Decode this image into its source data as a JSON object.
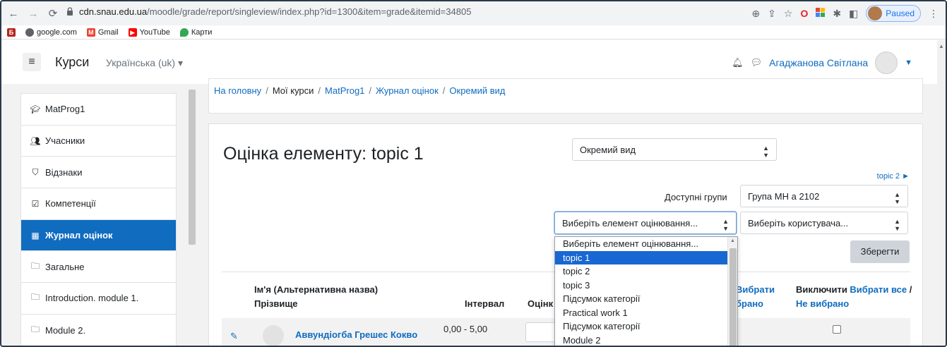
{
  "browser": {
    "url_host": "cdn.snau.edu.ua",
    "url_path": "/moodle/grade/report/singleview/index.php?id=1300&item=grade&itemid=34805",
    "profile_status": "Paused"
  },
  "bookmarks": [
    {
      "label": "",
      "icon": "b-logo-icon",
      "color": "#b3261e"
    },
    {
      "label": "google.com",
      "icon": "globe-icon",
      "color": "#5f6368"
    },
    {
      "label": "Gmail",
      "icon": "gmail-icon",
      "color": "#ea4335"
    },
    {
      "label": "YouTube",
      "icon": "youtube-icon",
      "color": "#ff0000"
    },
    {
      "label": "Карти",
      "icon": "maps-pin-icon",
      "color": "#34a853"
    }
  ],
  "navbar": {
    "brand": "Курси",
    "language": "Українська (uk) ▾",
    "user_name": "Агаджанова Світлана"
  },
  "drawer": {
    "items": [
      {
        "label": "MatProg1",
        "icon": "graduation-cap-icon",
        "glyph": "🎓",
        "active": false
      },
      {
        "label": "Учасники",
        "icon": "users-icon",
        "glyph": "👥",
        "active": false
      },
      {
        "label": "Відзнаки",
        "icon": "shield-icon",
        "glyph": "🛡",
        "active": false
      },
      {
        "label": "Компетенції",
        "icon": "checkbox-icon",
        "glyph": "☑",
        "active": false
      },
      {
        "label": "Журнал оцінок",
        "icon": "table-icon",
        "glyph": "▦",
        "active": true
      },
      {
        "label": "Загальне",
        "icon": "folder-icon",
        "glyph": "🗀",
        "active": false
      },
      {
        "label": "Introduction. module 1.",
        "icon": "folder-icon",
        "glyph": "🗀",
        "active": false
      },
      {
        "label": "Module 2.",
        "icon": "folder-icon",
        "glyph": "🗀",
        "active": false
      }
    ]
  },
  "breadcrumb": {
    "home": "На головну",
    "my_courses": "Мої курси",
    "course": "MatProg1",
    "gradebook": "Журнал оцінок",
    "current": "Окремий вид"
  },
  "page": {
    "title": "Оцінка елементу: topic 1",
    "view_select": "Окремий вид",
    "next_link": "topic 2 ►",
    "groups_label": "Доступні групи",
    "group_select": "Група МН а 2102",
    "item_select": "Виберіть елемент оцінювання...",
    "user_select": "Виберіть користувача...",
    "save_button": "Зберегти"
  },
  "table": {
    "col_name_line1": "Ім'я (Альтернативна назва)",
    "col_name_line2": "Прізвище",
    "col_interval": "Інтервал",
    "col_grade": "Оцінк",
    "col_override_line1": "Вибрати",
    "col_override_line2": "брано",
    "col_exclude_text": "Виключити ",
    "col_exclude_all": "Вибрати все",
    "col_exclude_slash": " / ",
    "col_exclude_none": "Не вибрано",
    "rows": [
      {
        "name": "Аввундіогба Грешес Кокво",
        "interval": "0,00 - 5,00"
      }
    ]
  },
  "dropdown": {
    "options": [
      "Виберіть елемент оцінювання...",
      "topic 1",
      "topic 2",
      "topic 3",
      "Підсумок категорії",
      "Practical work 1",
      "Підсумок категорії",
      "Module 2"
    ],
    "highlighted_index": 1
  },
  "colors": {
    "accent": "#0f6cbf",
    "highlight": "#1967d2"
  }
}
